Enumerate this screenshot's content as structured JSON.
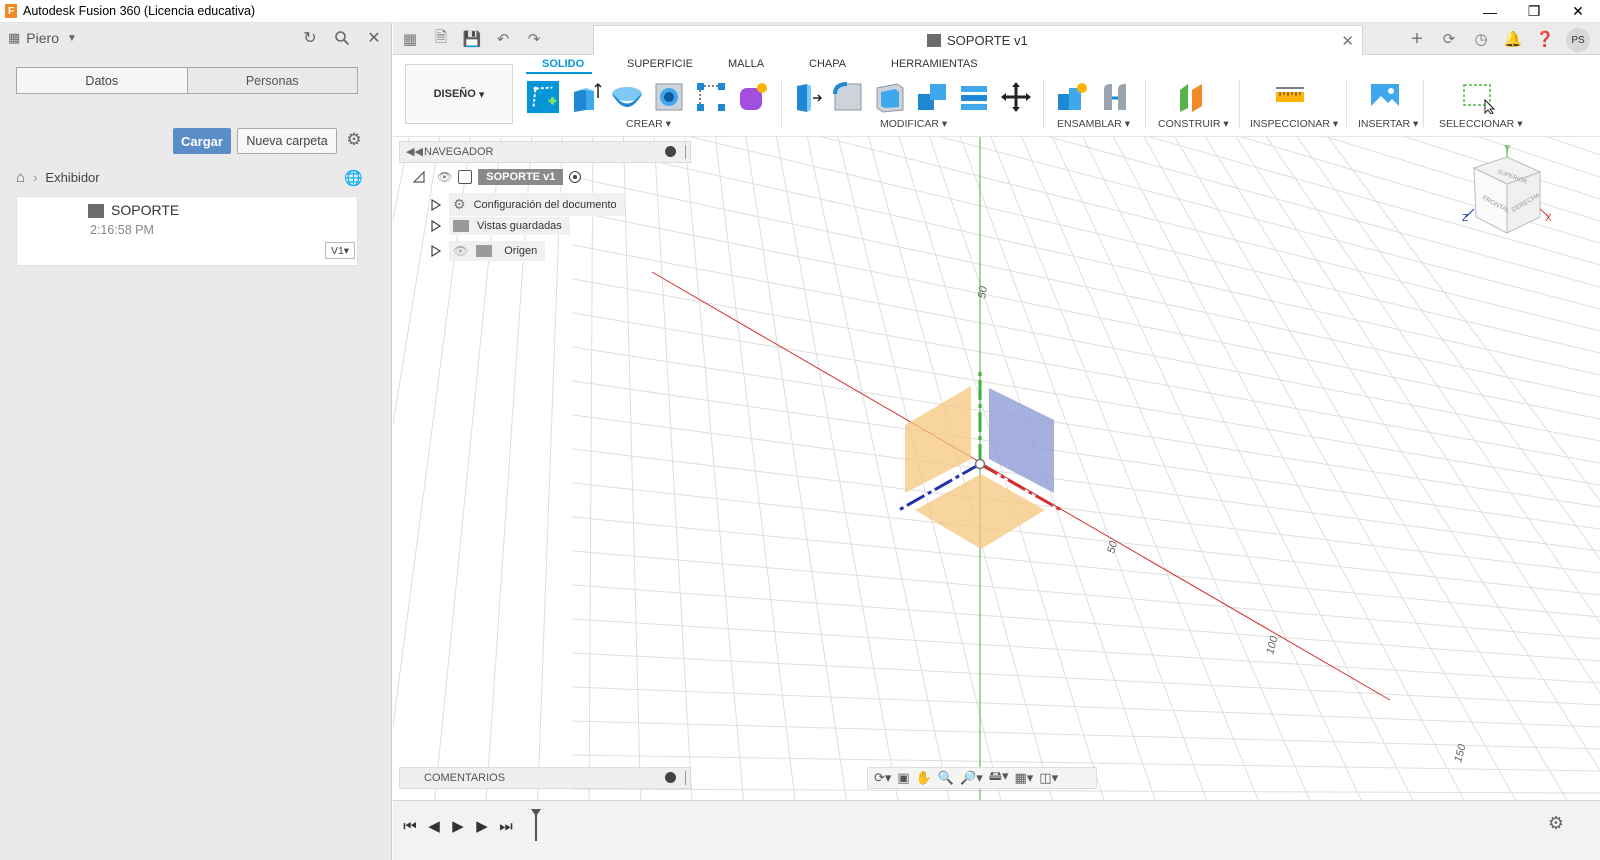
{
  "window": {
    "title": "Autodesk Fusion 360 (Licencia educativa)",
    "app_logo": "F",
    "controls": [
      "minimize-icon",
      "restore-icon",
      "close-icon"
    ]
  },
  "data_panel": {
    "user": "Piero",
    "tabs": [
      "Datos",
      "Personas"
    ],
    "upload_button": "Cargar",
    "new_folder_button": "Nueva carpeta",
    "breadcrumb": "Exhibidor",
    "files": [
      {
        "name": "SOPORTE",
        "time": "2:16:58 PM",
        "version": "V1"
      }
    ]
  },
  "tabstrip": {
    "document_title": "SOPORTE v1",
    "avatar_initials": "PS"
  },
  "ribbon": {
    "workspace": "DISEÑO",
    "tabs": [
      "SOLIDO",
      "SUPERFICIE",
      "MALLA",
      "CHAPA",
      "HERRAMIENTAS"
    ],
    "active_tab": "SOLIDO",
    "groups": [
      "CREAR",
      "MODIFICAR",
      "ENSAMBLAR",
      "CONSTRUIR",
      "INSPECCIONAR",
      "INSERTAR",
      "SELECCIONAR"
    ]
  },
  "browser": {
    "title": "NAVEGADOR",
    "root": "SOPORTE v1",
    "items": [
      "Configuración del documento",
      "Vistas guardadas",
      "Origen"
    ]
  },
  "comments": {
    "title": "COMENTARIOS"
  },
  "viewport": {
    "axis_labels": [
      "50",
      "50",
      "100",
      "150"
    ],
    "viewcube_faces": [
      "SUPERIOR",
      "FRONTAL",
      "DERECHA"
    ],
    "viewcube_axes": [
      "Y",
      "Z",
      "X"
    ],
    "colors": {
      "x_axis": "#d03030",
      "y_axis": "#3cb043",
      "z_axis": "#2233aa",
      "plane_orange": "#f5c77e",
      "plane_blue": "#8f9cd6",
      "accent": "#0696d7"
    }
  }
}
